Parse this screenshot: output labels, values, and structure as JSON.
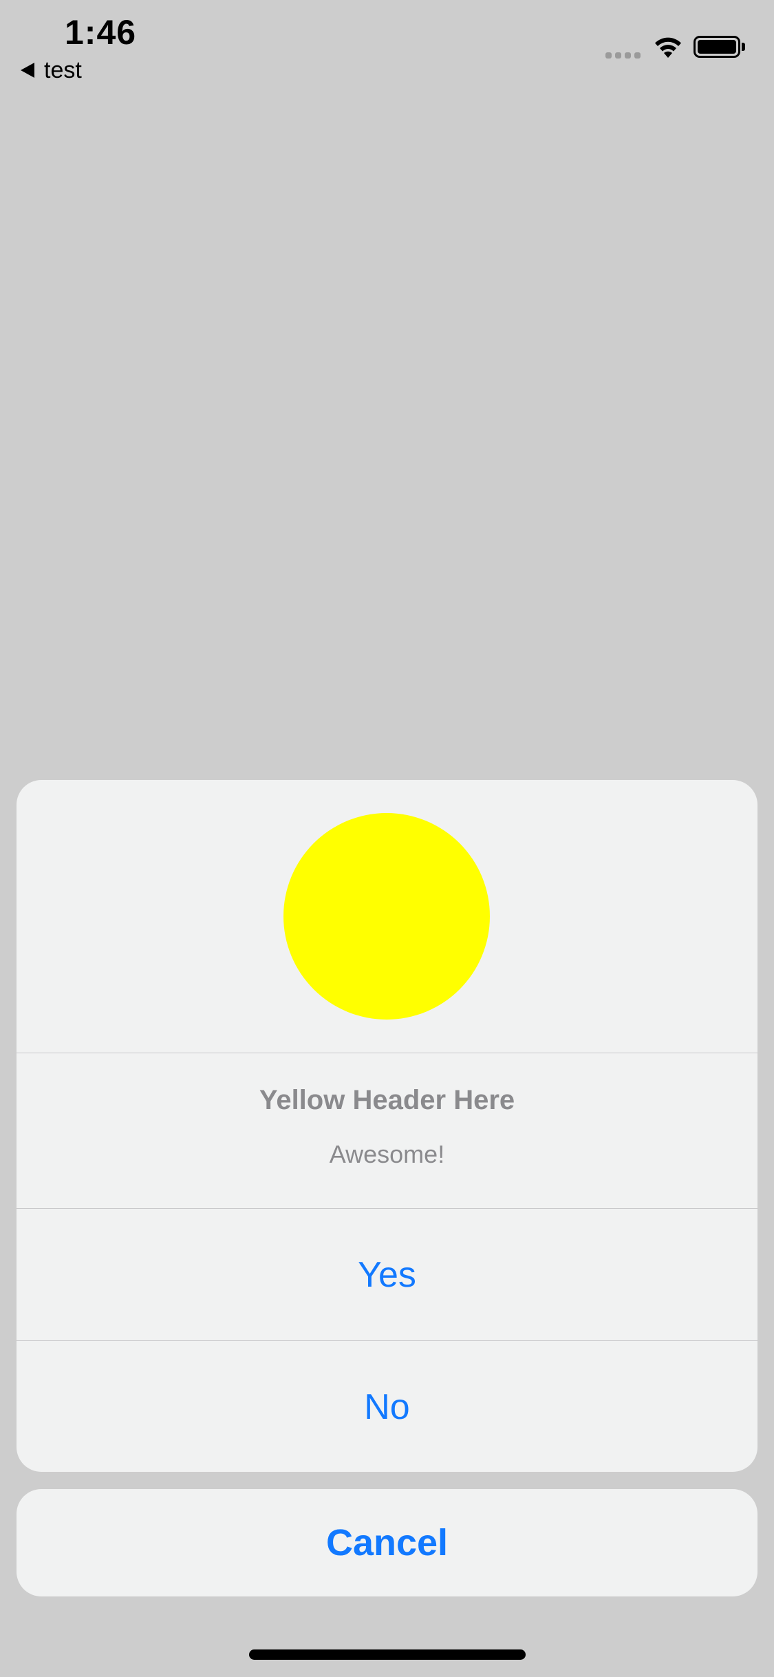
{
  "status_bar": {
    "time": "1:46",
    "back_label": "test",
    "icons": [
      "cellular-signal-icon",
      "wifi-icon",
      "battery-icon"
    ]
  },
  "action_sheet": {
    "image": {
      "shape": "circle",
      "color": "#ffff00"
    },
    "title": "Yellow Header Here",
    "message": "Awesome!",
    "actions": [
      {
        "label": "Yes"
      },
      {
        "label": "No"
      }
    ],
    "cancel_label": "Cancel",
    "accent_color": "#1279ff"
  }
}
